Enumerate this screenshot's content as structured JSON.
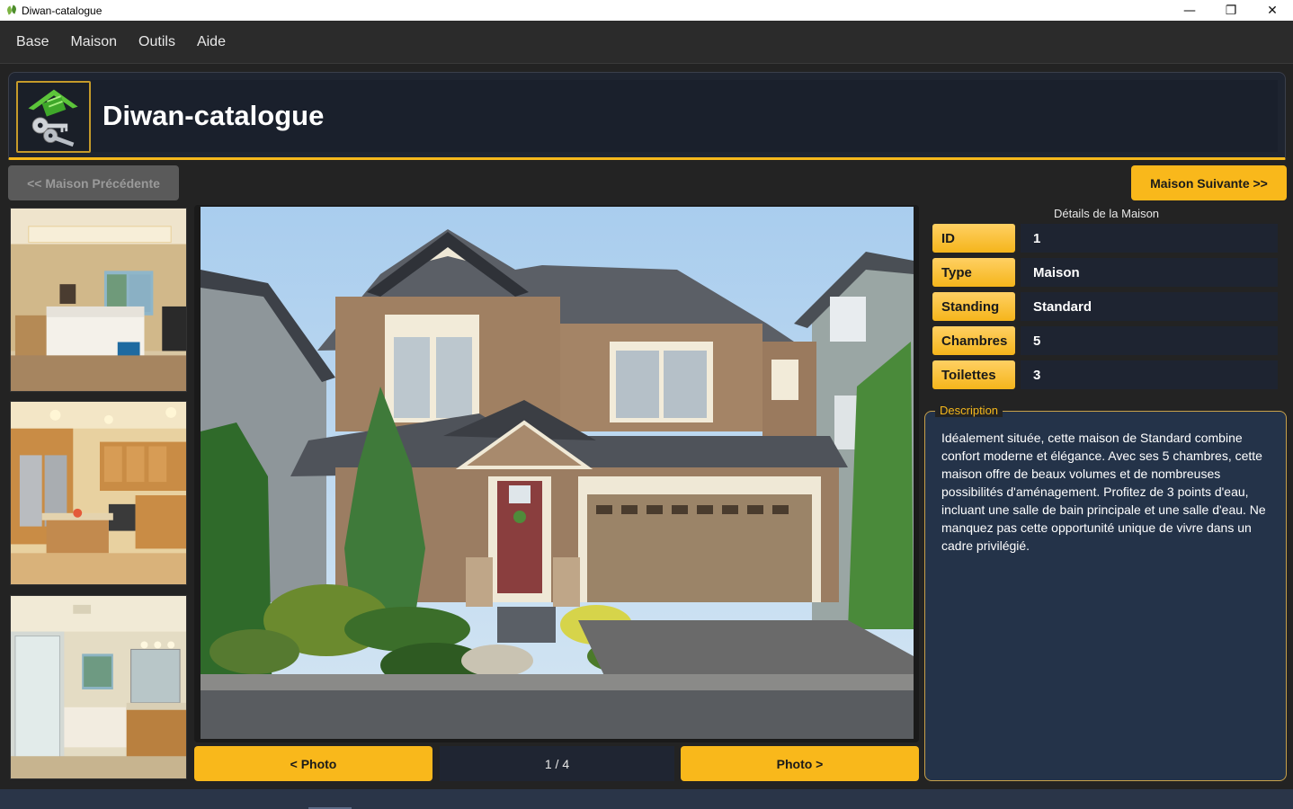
{
  "window": {
    "title": "Diwan-catalogue",
    "controls": {
      "minimize": "—",
      "restore": "❐",
      "close": "✕"
    }
  },
  "menu": [
    "Base",
    "Maison",
    "Outils",
    "Aide"
  ],
  "header": {
    "title": "Diwan-catalogue",
    "logo_icon": "house-keys-icon"
  },
  "navigation": {
    "prev_house": "<< Maison Précédente",
    "next_house": "Maison Suivante >>"
  },
  "photo": {
    "prev_label": "< Photo",
    "next_label": "Photo >",
    "counter": "1 / 4"
  },
  "details": {
    "title": "Détails de la Maison",
    "rows": [
      {
        "label": "ID",
        "value": "1"
      },
      {
        "label": "Type",
        "value": "Maison"
      },
      {
        "label": "Standing",
        "value": "Standard"
      },
      {
        "label": "Chambres",
        "value": "5"
      },
      {
        "label": "Toilettes",
        "value": "3"
      }
    ]
  },
  "description": {
    "legend": "Description",
    "text": "Idéalement située, cette maison de Standard combine confort moderne et élégance. Avec ses 5 chambres, cette maison offre de beaux volumes et de nombreuses possibilités d'aménagement. Profitez de 3 points d'eau, incluant une salle de bain principale et une salle d'eau. Ne manquez pas cette opportunité unique de vivre dans un cadre privilégié."
  },
  "colors": {
    "accent": "#f9b81b",
    "background": "#232323",
    "panel": "#1e2431",
    "description_bg": "#243349"
  }
}
